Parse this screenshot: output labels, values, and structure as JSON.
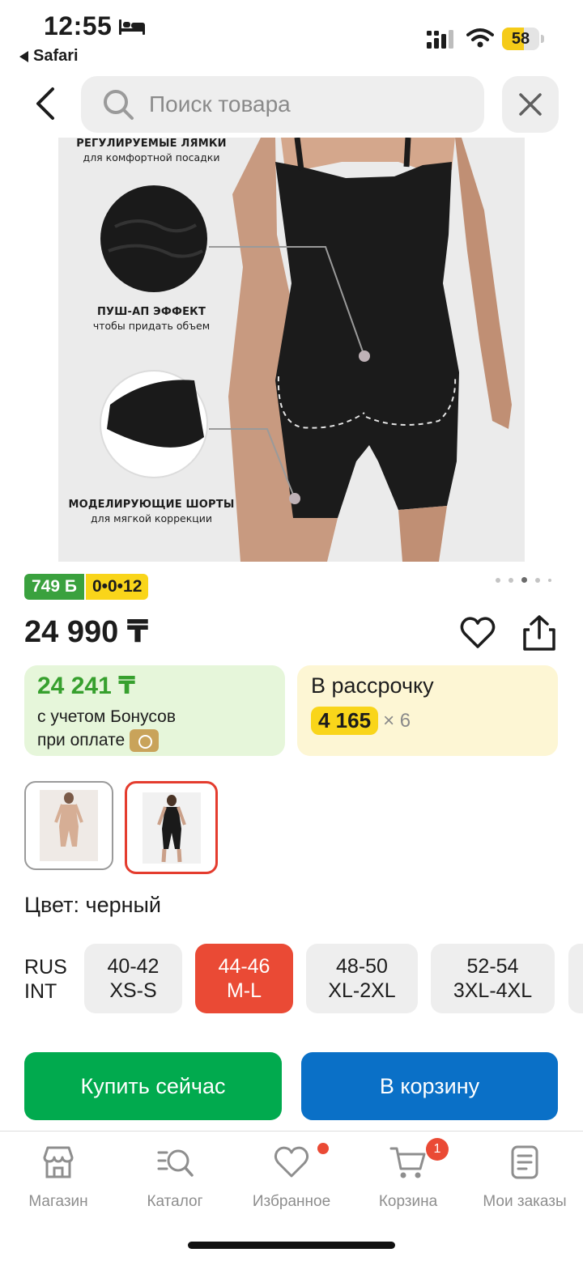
{
  "status_bar": {
    "time": "12:55",
    "back_app": "Safari",
    "battery_level": 58,
    "battery_label": "58",
    "battery_color": "#f5cb18"
  },
  "search": {
    "placeholder": "Поиск товара",
    "value": "",
    "icons": {
      "back": "chevron-left-icon",
      "search": "search-icon",
      "close": "close-icon"
    }
  },
  "product_image": {
    "callouts": [
      {
        "title": "РЕГУЛИРУЕМЫЕ ЛЯМКИ",
        "subtitle": "для комфортной посадки"
      },
      {
        "title": "ПУШ-АП ЭФФЕКТ",
        "subtitle": "чтобы придать объем"
      },
      {
        "title": "МОДЕЛИРУЮЩИЕ ШОРТЫ",
        "subtitle": "для мягкой коррекции"
      }
    ],
    "carousel": {
      "total": 5,
      "active_index": 3
    }
  },
  "badges": {
    "bonus": "749 Б",
    "installment": "0•0•12",
    "bonus_color": "#3aa13e",
    "installment_color": "#f9d51a"
  },
  "price": {
    "current": "24 990 ₸",
    "icons": {
      "favorite": "heart-icon",
      "share": "share-icon"
    }
  },
  "bonus_card": {
    "price": "24 241 ₸",
    "line1": "с учетом Бонусов",
    "line2": "при оплате"
  },
  "installment_card": {
    "title": "В рассрочку",
    "amount": "4 165",
    "multiplier": "× 6"
  },
  "variants": [
    {
      "name": "nude",
      "selected": false
    },
    {
      "name": "black",
      "selected": true
    }
  ],
  "color_label": "Цвет: черный",
  "sizes": {
    "axis_labels": [
      "RUS",
      "INT"
    ],
    "options": [
      {
        "rus": "40-42",
        "int": "XS-S",
        "selected": false
      },
      {
        "rus": "44-46",
        "int": "M-L",
        "selected": true
      },
      {
        "rus": "48-50",
        "int": "XL-2XL",
        "selected": false
      },
      {
        "rus": "52-54",
        "int": "3XL-4XL",
        "selected": false
      }
    ],
    "accent_color": "#ea4a35"
  },
  "actions": {
    "buy_now": "Купить сейчас",
    "add_to_cart": "В корзину",
    "buy_color": "#01aa4e",
    "cart_color": "#0a70c7"
  },
  "tabbar": {
    "items": [
      {
        "label": "Магазин",
        "icon": "store-icon"
      },
      {
        "label": "Каталог",
        "icon": "catalog-search-icon"
      },
      {
        "label": "Избранное",
        "icon": "heart-icon"
      },
      {
        "label": "Корзина",
        "icon": "cart-icon"
      },
      {
        "label": "Мои заказы",
        "icon": "orders-icon"
      }
    ],
    "cart_count": "1"
  }
}
